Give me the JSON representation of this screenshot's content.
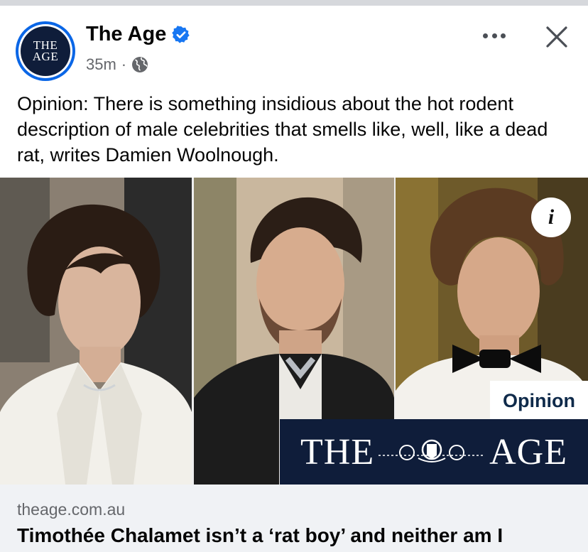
{
  "post": {
    "page_name": "The Age",
    "avatar_text_line1": "THE",
    "avatar_text_line2": "AGE",
    "timestamp": "35m",
    "separator": "·",
    "audience_icon": "globe-icon",
    "verified_icon": "verified-badge-icon",
    "text": "Opinion: There is something insidious about the hot rodent description of male celebrities that smells like, well, like a dead rat, writes Damien Woolnough."
  },
  "actions": {
    "more_icon": "more-options-icon",
    "close_icon": "close-icon"
  },
  "image": {
    "info_label": "i",
    "badge_label": "Opinion",
    "brand_left": "THE",
    "brand_right": "AGE",
    "crest_icon": "crest-icon"
  },
  "link": {
    "domain": "theage.com.au",
    "title": "Timothée Chalamet isn’t a ‘rat boy’ and neither am I"
  },
  "colors": {
    "verified_blue": "#1877f2",
    "brand_navy": "#0f1d3a",
    "secondary_text": "#65676b",
    "footer_bg": "#f0f2f5"
  }
}
